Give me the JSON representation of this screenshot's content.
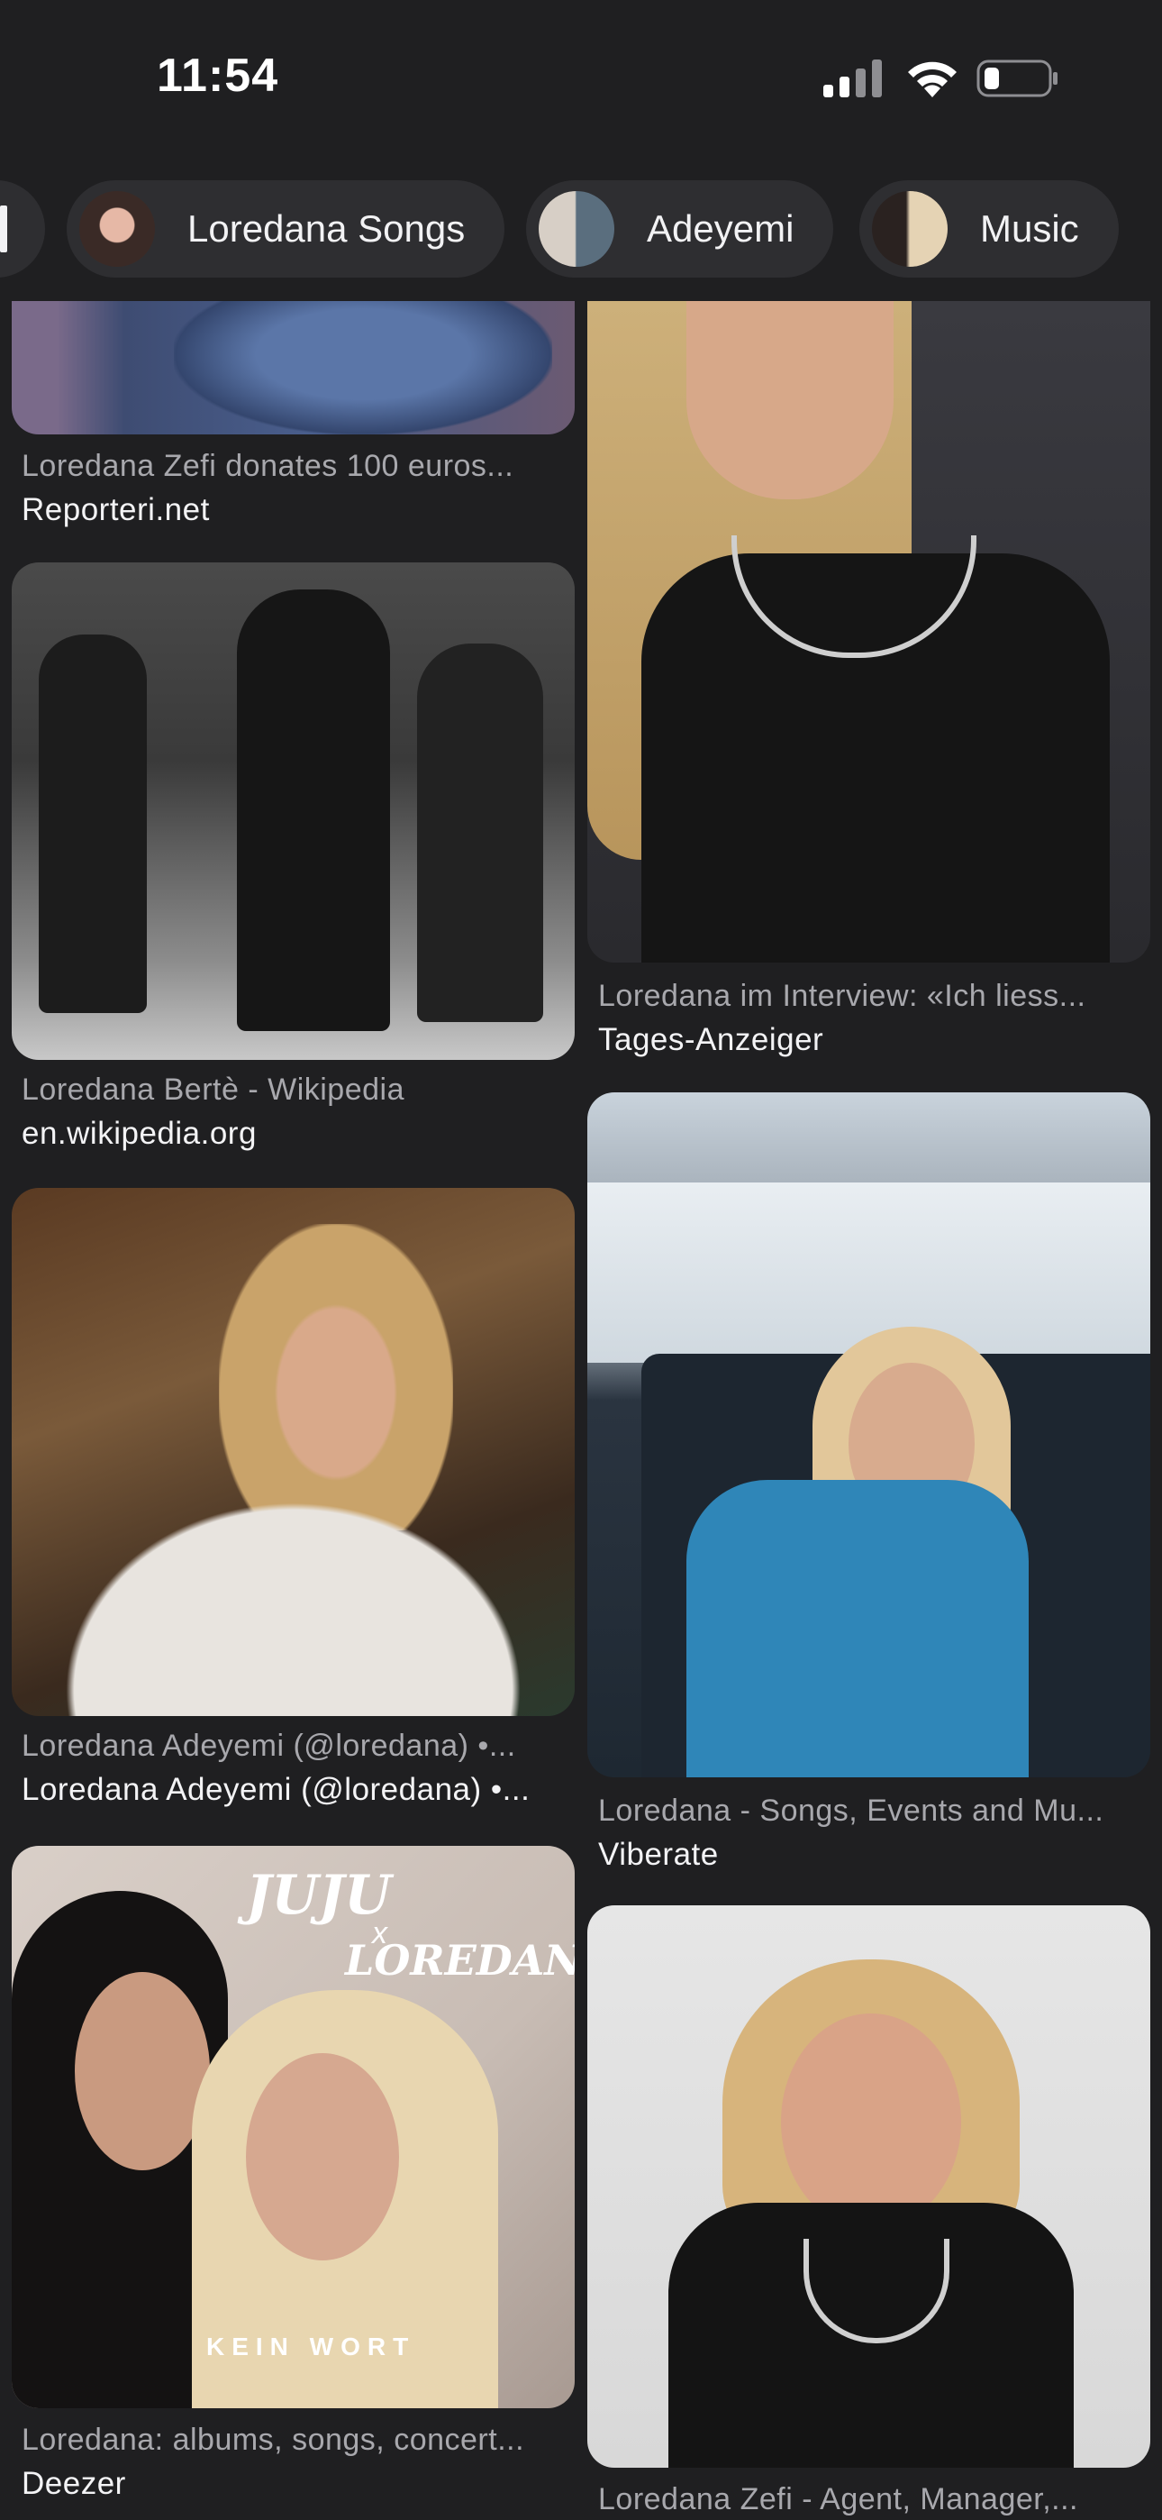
{
  "status_bar": {
    "time": "11:54"
  },
  "chips": [
    {
      "label": "Loredana Songs",
      "icon": "avatar-face"
    },
    {
      "label": "Adeyemi",
      "icon": "avatar-group"
    },
    {
      "label": "Music",
      "icon": "avatar-duo"
    }
  ],
  "results": [
    {
      "caption": "Loredana Zefi donates 100 euros...",
      "source": "Reporteri.net"
    },
    {
      "caption": "Loredana im Interview: «Ich liess...",
      "source": "Tages-Anzeiger"
    },
    {
      "caption": "Loredana Bertè - Wikipedia",
      "source": "en.wikipedia.org"
    },
    {
      "caption": "Loredana Adeyemi (@loredana) •...",
      "source": "Loredana Adeyemi (@loredana) •..."
    },
    {
      "caption": "Loredana - Songs, Events and Mu...",
      "source": "Viberate"
    },
    {
      "caption": "Loredana: albums, songs, concert...",
      "source": "Deezer"
    },
    {
      "caption": "Loredana Zefi - Agent, Manager,...",
      "source": ""
    }
  ],
  "album_art": {
    "title": "JUJU",
    "cross": "x",
    "artist": "LOREDANA",
    "song": "KEIN WORT"
  },
  "colors": {
    "background": "#1f1f21",
    "chip": "#2e2e31",
    "caption": "#a8a8ad",
    "source": "#f3f3f5"
  }
}
